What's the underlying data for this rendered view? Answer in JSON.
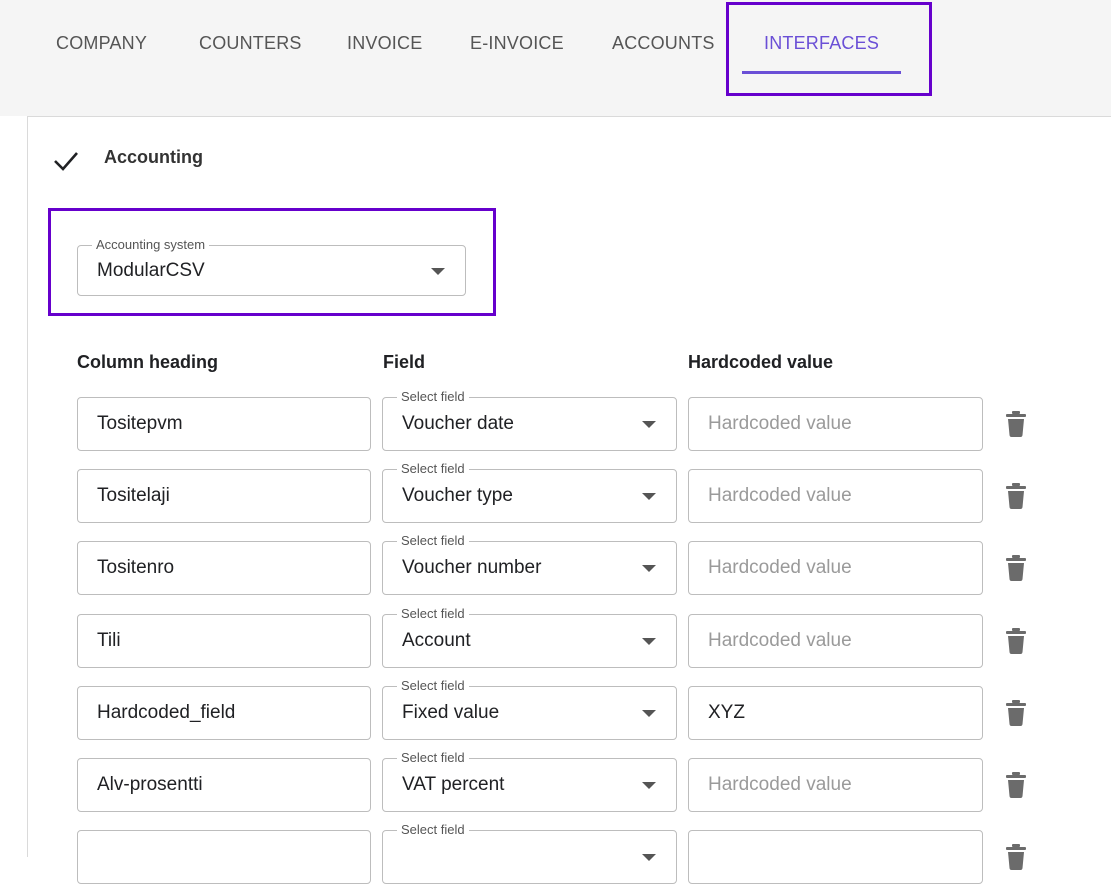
{
  "tabs": [
    {
      "label": "COMPANY"
    },
    {
      "label": "COUNTERS"
    },
    {
      "label": "INVOICE"
    },
    {
      "label": "E-INVOICE"
    },
    {
      "label": "ACCOUNTS"
    },
    {
      "label": "INTERFACES",
      "active": true
    }
  ],
  "section": {
    "title": "Accounting",
    "icon": "check-icon"
  },
  "accounting_system": {
    "label": "Accounting system",
    "value": "ModularCSV"
  },
  "columns": {
    "heading": "Column heading",
    "field": "Field",
    "hardcoded": "Hardcoded value"
  },
  "field_label": "Select field",
  "hardcoded_placeholder": "Hardcoded value",
  "rows": [
    {
      "heading": "Tositepvm",
      "field": "Voucher date",
      "hardcoded": ""
    },
    {
      "heading": "Tositelaji",
      "field": "Voucher type",
      "hardcoded": ""
    },
    {
      "heading": "Tositenro",
      "field": "Voucher number",
      "hardcoded": ""
    },
    {
      "heading": "Tili",
      "field": "Account",
      "hardcoded": ""
    },
    {
      "heading": "Hardcoded_field",
      "field": "Fixed value",
      "hardcoded": "XYZ"
    },
    {
      "heading": "Alv-prosentti",
      "field": "VAT percent",
      "hardcoded": ""
    },
    {
      "heading": "",
      "field": "",
      "hardcoded": ""
    }
  ],
  "colors": {
    "accent": "#6a4fd6",
    "highlight": "#6600cc"
  }
}
